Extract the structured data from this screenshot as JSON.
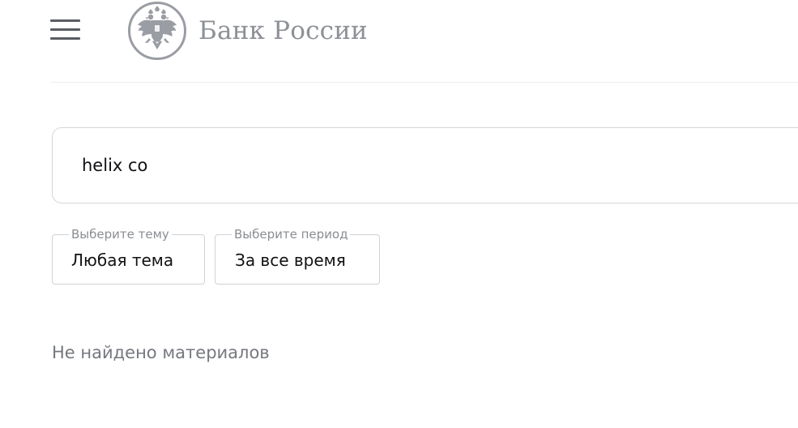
{
  "header": {
    "menu_icon": "hamburger-menu-icon",
    "logo_icon": "double-headed-eagle-emblem-icon",
    "logo_text": "Банк России"
  },
  "search": {
    "value": "helix co"
  },
  "filters": {
    "theme": {
      "legend": "Выберите тему",
      "value": "Любая тема"
    },
    "period": {
      "legend": "Выберите период",
      "value": "За все время"
    }
  },
  "results": {
    "empty_message": "Не найдено материалов"
  },
  "colors": {
    "text_primary": "#111214",
    "text_muted": "#75787e",
    "logo_gray": "#8d9096",
    "border": "#d3d6db"
  }
}
